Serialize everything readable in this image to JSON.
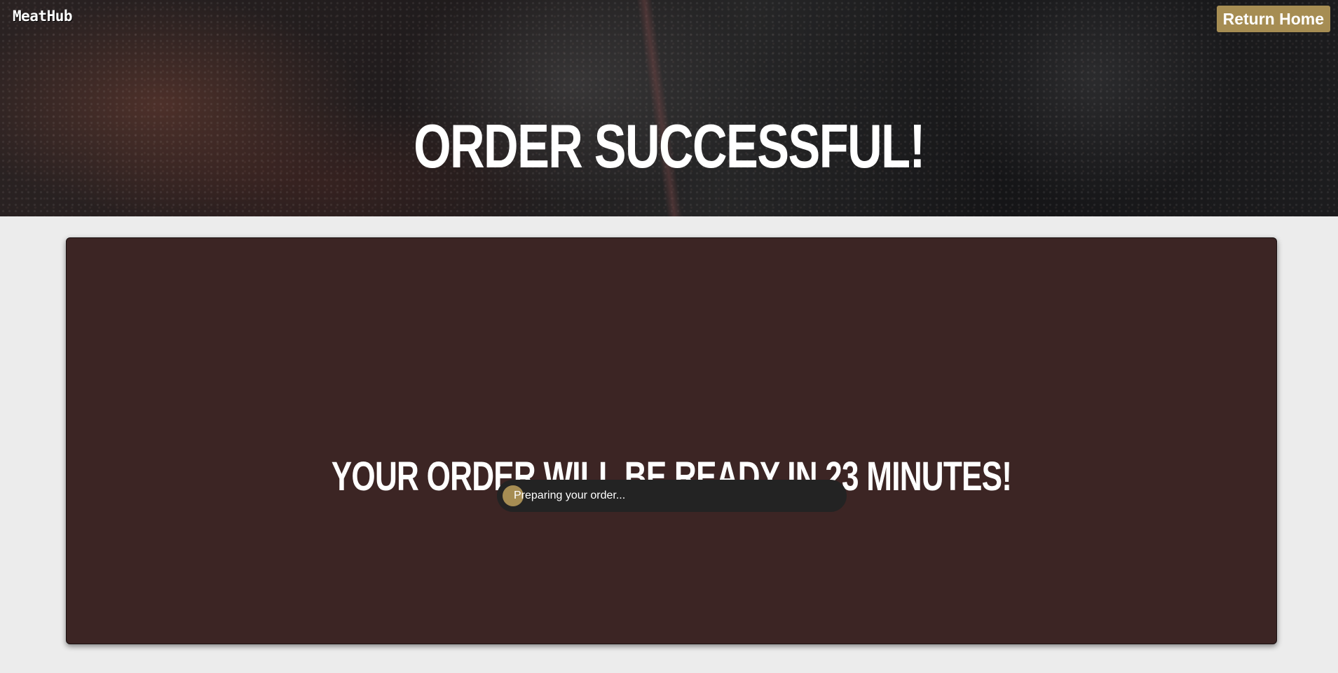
{
  "header": {
    "brand": "MeatHub",
    "return_home_label": "Return Home",
    "title": "ORDER SUCCESSFUL!"
  },
  "status_card": {
    "message": "YOUR ORDER WILL BE READY IN 23 MINUTES!",
    "progress_label": "Preparing your order...",
    "progress_fraction": 0.06
  },
  "colors": {
    "accent": "#a68d53",
    "card_background": "#3c2524",
    "progress_track": "#232323",
    "page_background": "#ececec"
  }
}
